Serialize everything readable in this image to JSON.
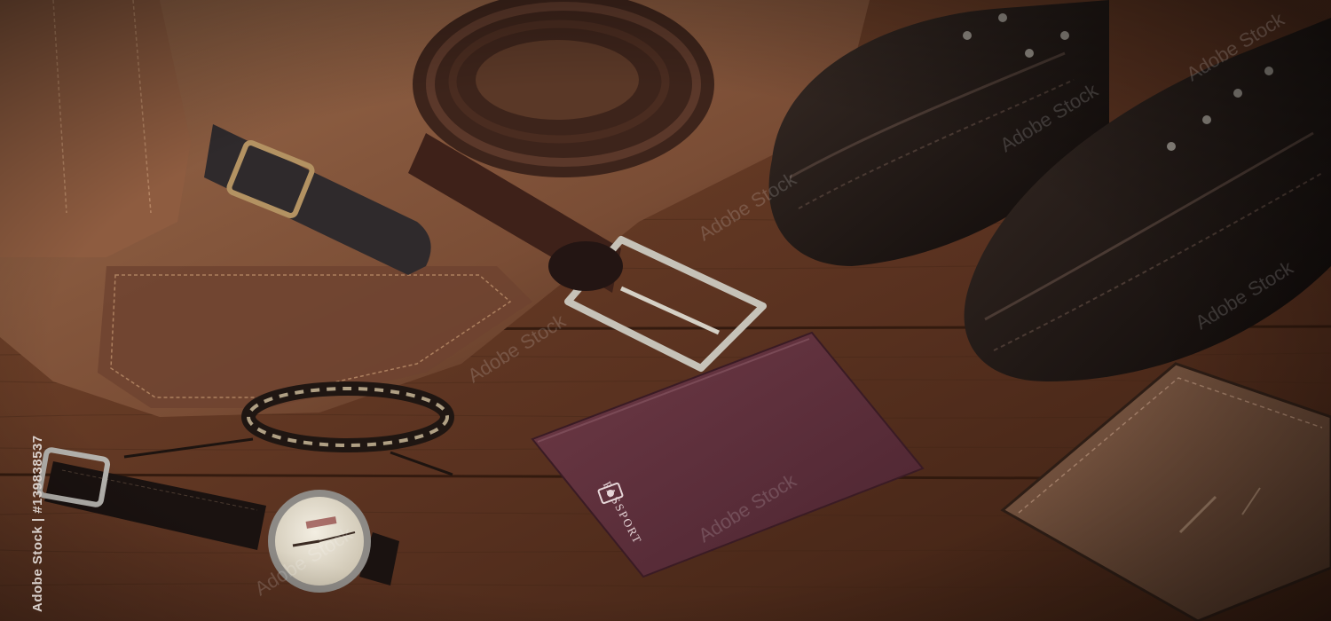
{
  "passport": {
    "title": "PASSPORT"
  },
  "watch": {
    "brand_text": ""
  },
  "stock_badge": {
    "text": "Adobe Stock | #139838537"
  },
  "watermark": {
    "text": "Adobe Stock"
  },
  "colors": {
    "wood_dark": "#2a160c",
    "wood_mid": "#6a3b22",
    "bag_brown": "#8a5a3e",
    "belt_dark": "#3b241c",
    "shoe_black": "#17110f",
    "passport_burgundy": "#5c2d38",
    "wallet_brown": "#6b4a37"
  }
}
